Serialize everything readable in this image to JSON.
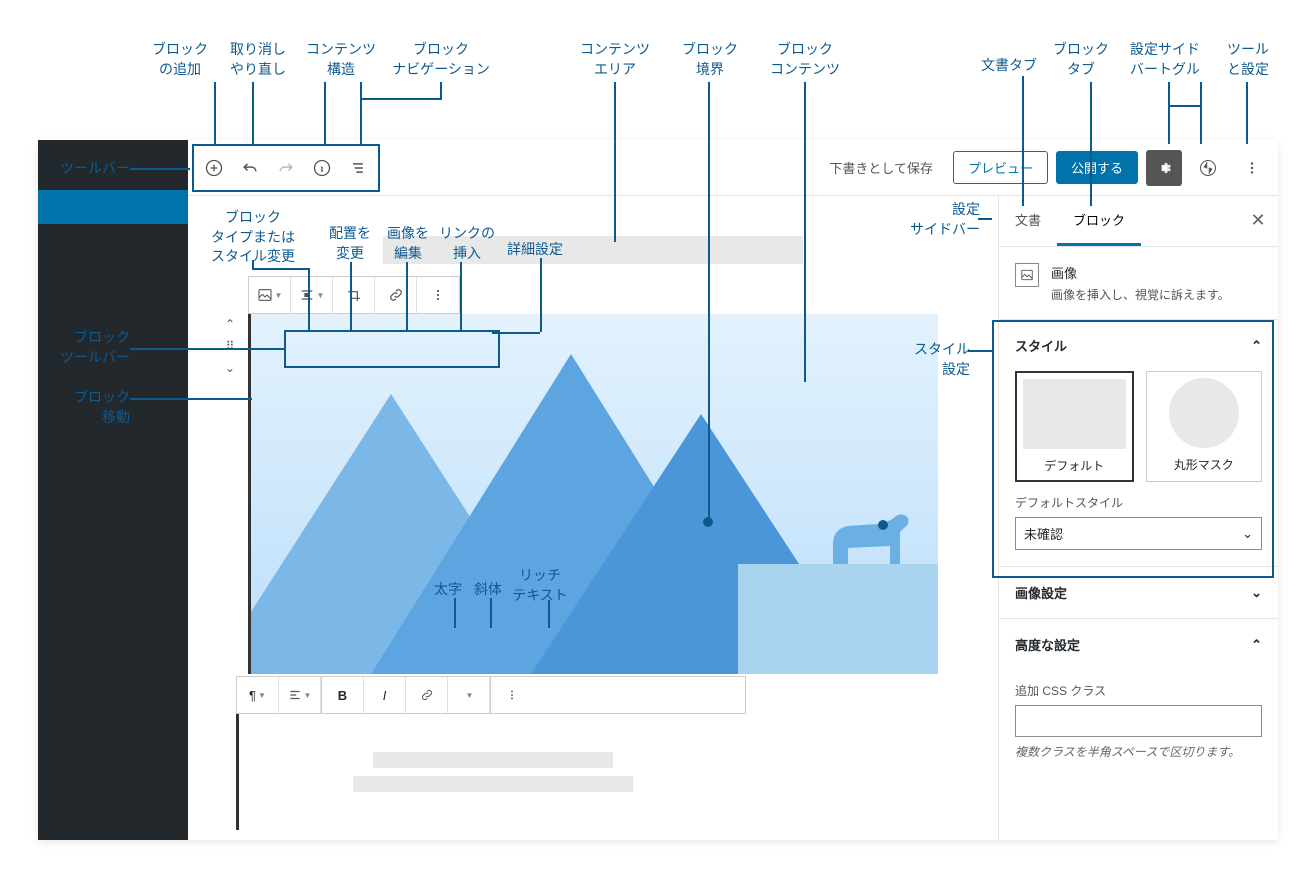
{
  "annotations": {
    "add_block": "ブロック\nの追加",
    "undo_redo": "取り消し\nやり直し",
    "content_structure": "コンテンツ\n構造",
    "block_nav": "ブロック\nナビゲーション",
    "content_area": "コンテンツ\nエリア",
    "block_boundary": "ブロック\n境界",
    "block_contents": "ブロック\nコンテンツ",
    "document_tab": "文書タブ",
    "block_tab": "ブロック\nタブ",
    "settings_toggle": "設定サイド\nバートグル",
    "tools_settings": "ツール\nと設定",
    "toolbar": "ツールバー",
    "block_type": "ブロック\nタイプまたは\nスタイル変更",
    "change_align": "配置を\n変更",
    "edit_image": "画像を\n編集",
    "insert_link": "リンクの\n挿入",
    "more_settings": "詳細設定",
    "settings_sidebar": "設定\nサイドバー",
    "block_toolbar": "ブロック\nツールバー",
    "block_move": "ブロック\n移動",
    "style_settings": "スタイル\n設定",
    "bold": "太字",
    "italic": "斜体",
    "rich_text": "リッチ\nテキスト"
  },
  "toolbar": {
    "save_draft": "下書きとして保存",
    "preview": "プレビュー",
    "publish": "公開する"
  },
  "sidebar": {
    "tab_document": "文書",
    "tab_block": "ブロック",
    "block_name": "画像",
    "block_desc": "画像を挿入し、視覚に訴えます。",
    "style_heading": "スタイル",
    "style_default": "デフォルト",
    "style_round": "丸形マスク",
    "default_style_label": "デフォルトスタイル",
    "default_style_value": "未確認",
    "image_settings": "画像設定",
    "advanced": "高度な設定",
    "css_label": "追加 CSS クラス",
    "css_help": "複数クラスを半角スペースで区切ります。"
  }
}
